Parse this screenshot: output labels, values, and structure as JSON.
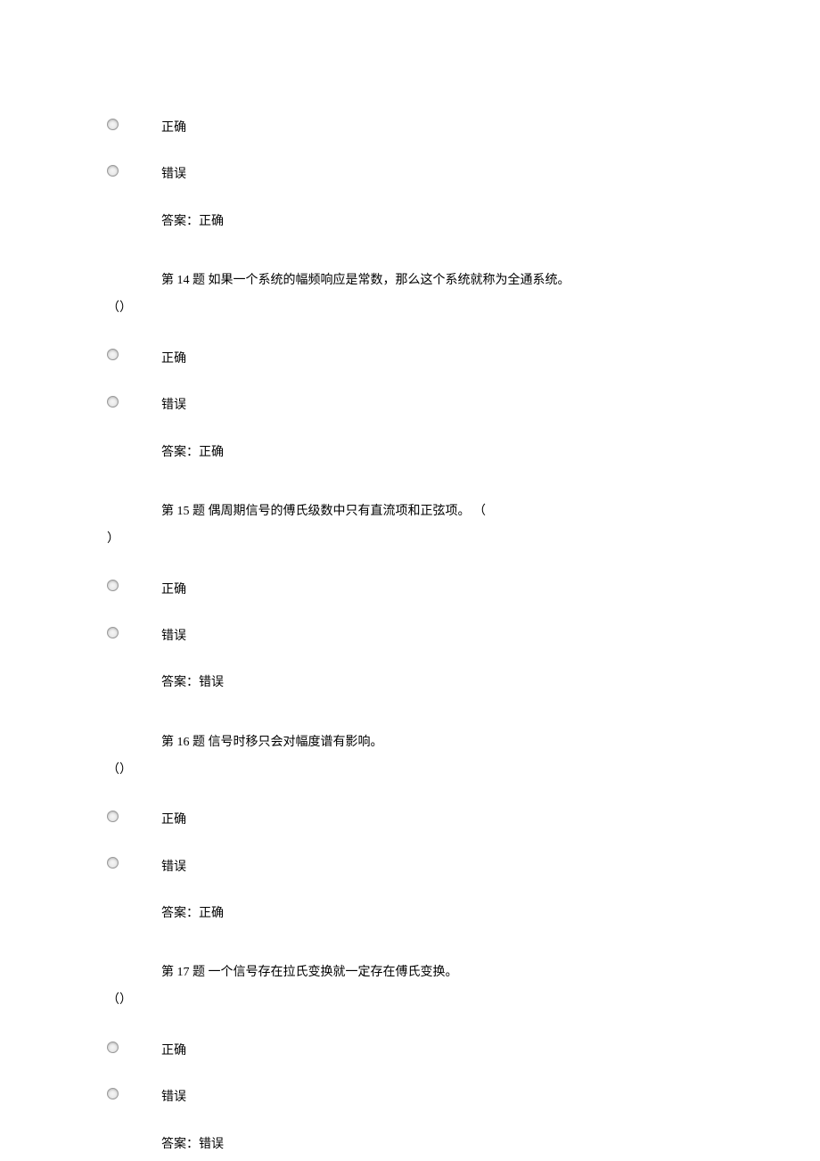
{
  "labels": {
    "correct": "正确",
    "incorrect": "错误",
    "answerPrefix": "答案：",
    "marker": "（）"
  },
  "q13": {
    "answer": "正确"
  },
  "q14": {
    "prefix": "第 14 题 ",
    "text": "如果一个系统的幅频响应是常数，那么这个系统就称为全通系统。",
    "answer": "正确"
  },
  "q15": {
    "prefix": "第 15 题 ",
    "text": "偶周期信号的傅氏级数中只有直流项和正弦项。 （",
    "closeParen": "）",
    "answer": "错误"
  },
  "q16": {
    "prefix": "第 16 题 ",
    "text": "信号时移只会对幅度谱有影响。",
    "answer": "正确"
  },
  "q17": {
    "prefix": "第 17 题 ",
    "text": "一个信号存在拉氏变换就一定存在傅氏变换。",
    "answer": "错误"
  }
}
